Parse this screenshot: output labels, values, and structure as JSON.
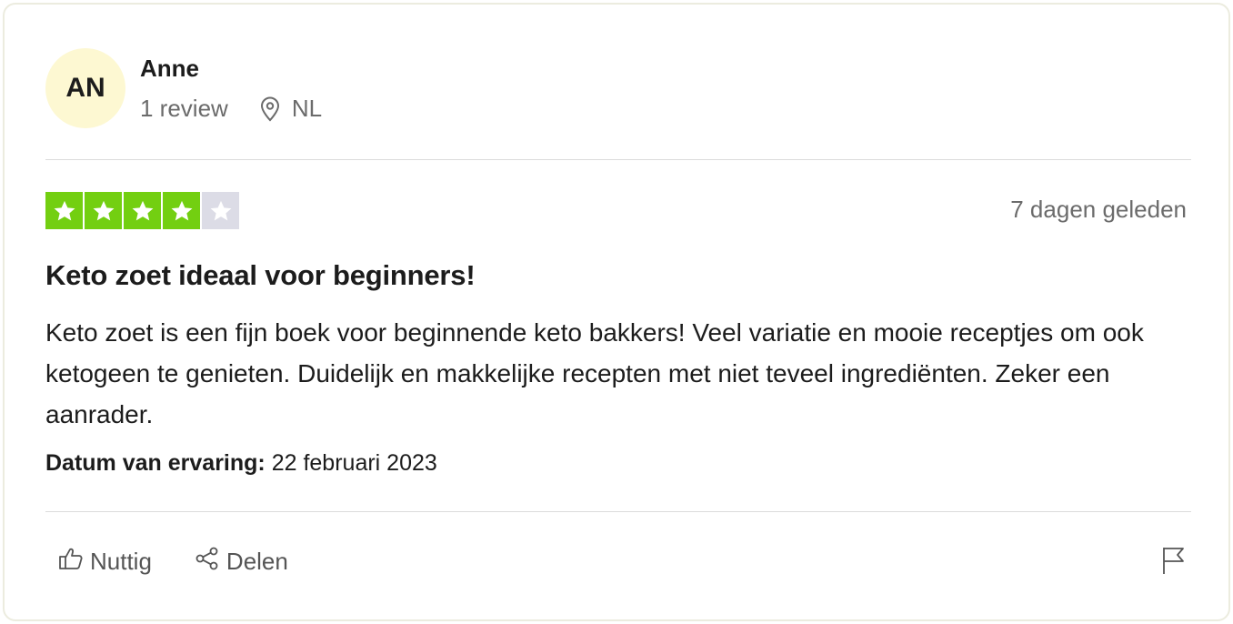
{
  "reviewer": {
    "initials": "AN",
    "name": "Anne",
    "review_count": "1 review",
    "country": "NL",
    "avatar_color": "#fdf8d2"
  },
  "review": {
    "rating": 4,
    "rating_max": 5,
    "star_color": "#73cf11",
    "star_empty_color": "#dcdce6",
    "posted_ago": "7 dagen geleden",
    "title": "Keto zoet ideaal voor beginners!",
    "body": "Keto zoet is een fijn boek voor beginnende keto bakkers! Veel variatie en mooie receptjes om ook ketogeen te genieten. Duidelijk en makkelijke recepten met niet teveel ingrediënten. Zeker een aanrader.",
    "experience_label": "Datum van ervaring:",
    "experience_date": "22 februari 2023"
  },
  "actions": {
    "useful_label": "Nuttig",
    "useful_icon": "thumbs-up-icon",
    "share_label": "Delen",
    "share_icon": "share-icon",
    "report_icon": "flag-icon"
  }
}
